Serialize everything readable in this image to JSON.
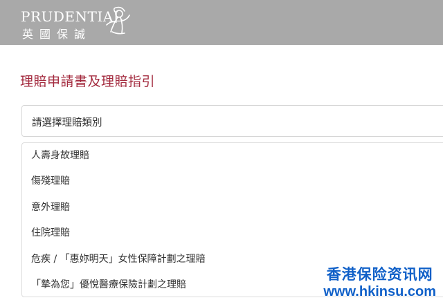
{
  "header": {
    "logo_text_en": "PRUDENTIAL",
    "logo_text_zh": "英國保誠",
    "logo_mark_icon": "prudence-figure-icon",
    "background_color": "#a9a9a9"
  },
  "main": {
    "title": "理賠申請書及理賠指引",
    "title_color": "#a32a3e",
    "select": {
      "value": "請選擇理賠類別"
    },
    "options": [
      {
        "label": "人壽身故理賠"
      },
      {
        "label": "傷殘理賠"
      },
      {
        "label": "意外理賠"
      },
      {
        "label": "住院理賠"
      },
      {
        "label": "危疾 / 「惠妳明天」女性保障計劃之理賠"
      },
      {
        "label": "「摯為您」優悅醫療保險計劃之理賠"
      }
    ]
  },
  "watermark": {
    "line1": "香港保险资讯网",
    "line2": "www.hkinsu.com",
    "color": "#1060c8"
  }
}
